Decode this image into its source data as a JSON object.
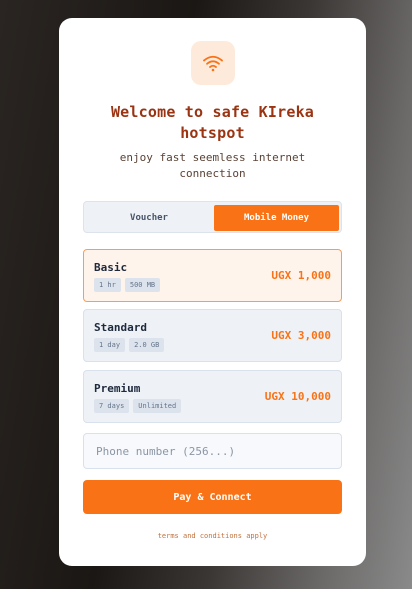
{
  "header": {
    "icon": "wifi-icon",
    "title_line1": "Welcome to safe KIreka",
    "title_line2": "hotspot",
    "subtitle_line1": "enjoy fast seemless internet",
    "subtitle_line2": "connection"
  },
  "tabs": [
    {
      "label": "Voucher",
      "active": false
    },
    {
      "label": "Mobile Money",
      "active": true
    }
  ],
  "plans": [
    {
      "name": "Basic",
      "duration": "1 hr",
      "data": "500 MB",
      "price": "UGX 1,000",
      "selected": true
    },
    {
      "name": "Standard",
      "duration": "1 day",
      "data": "2.0 GB",
      "price": "UGX 3,000",
      "selected": false
    },
    {
      "name": "Premium",
      "duration": "7 days",
      "data": "Unlimited",
      "price": "UGX 10,000",
      "selected": false
    }
  ],
  "phone": {
    "placeholder": "Phone number (256...)",
    "value": ""
  },
  "pay_button": {
    "label": "Pay & Connect"
  },
  "footer": {
    "terms": "terms and conditions apply"
  },
  "colors": {
    "accent": "#f97316",
    "title": "#9a3412",
    "card": "#ffffff"
  }
}
